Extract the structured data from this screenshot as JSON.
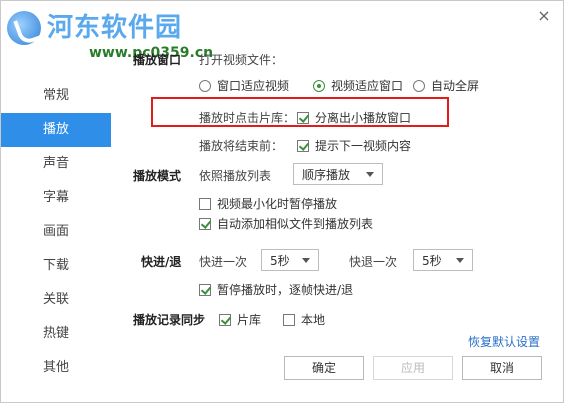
{
  "watermark": {
    "title": "河东软件园",
    "url": "www.pc0359.cn"
  },
  "sidebar": {
    "items": [
      {
        "label": "常规"
      },
      {
        "label": "播放",
        "active": true
      },
      {
        "label": "声音"
      },
      {
        "label": "字幕"
      },
      {
        "label": "画面"
      },
      {
        "label": "下载"
      },
      {
        "label": "关联"
      },
      {
        "label": "热键"
      },
      {
        "label": "其他"
      }
    ]
  },
  "playback_window": {
    "section": "播放窗口",
    "open_label": "打开视频文件：",
    "options": [
      "窗口适应视频",
      "视频适应窗口",
      "自动全屏"
    ],
    "selected": "视频适应窗口",
    "library_label": "播放时点击片库：",
    "library_option": "分离出小播放窗口",
    "end_label": "播放将结束前：",
    "end_option": "提示下一视频内容"
  },
  "play_mode": {
    "section": "播放模式",
    "playlist_label": "依照播放列表",
    "order_value": "顺序播放",
    "pause_minimized": "视频最小化时暂停播放",
    "auto_add": "自动添加相似文件到播放列表"
  },
  "seek": {
    "section": "快进/退",
    "forward_label": "快进一次",
    "forward_value": "5秒",
    "backward_label": "快退一次",
    "backward_value": "5秒",
    "frame_step": "暂停播放时，逐帧快进/退"
  },
  "sync": {
    "section": "播放记录同步",
    "library": "片库",
    "local": "本地"
  },
  "restore_defaults": "恢复默认设置",
  "buttons": {
    "ok": "确定",
    "apply": "应用",
    "cancel": "取消"
  },
  "colors": {
    "accent": "#2f8fe8",
    "highlight_box": "#e21b1b",
    "check": "#3a8f3a"
  }
}
